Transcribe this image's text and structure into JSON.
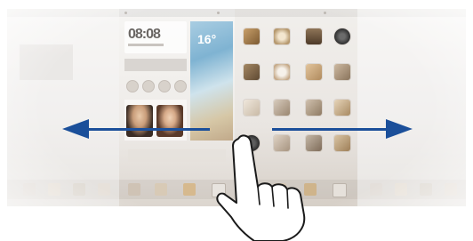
{
  "screen": {
    "clock_widget": {
      "time": "08:08"
    },
    "photo_widget": {
      "temperature": "16°"
    }
  },
  "gesture": {
    "hand_icon": "pointing-hand-icon",
    "left_arrow_icon": "arrow-left-icon",
    "right_arrow_icon": "arrow-right-icon",
    "arrow_color": "#1b4f9a"
  },
  "icons": {
    "apps": [
      "camera-icon",
      "clock-icon",
      "gallery-icon",
      "music-icon",
      "calendar-icon",
      "settings-icon",
      "contacts-icon",
      "mail-icon",
      "notes-icon",
      "phone-icon",
      "messages-icon",
      "browser-icon"
    ]
  }
}
